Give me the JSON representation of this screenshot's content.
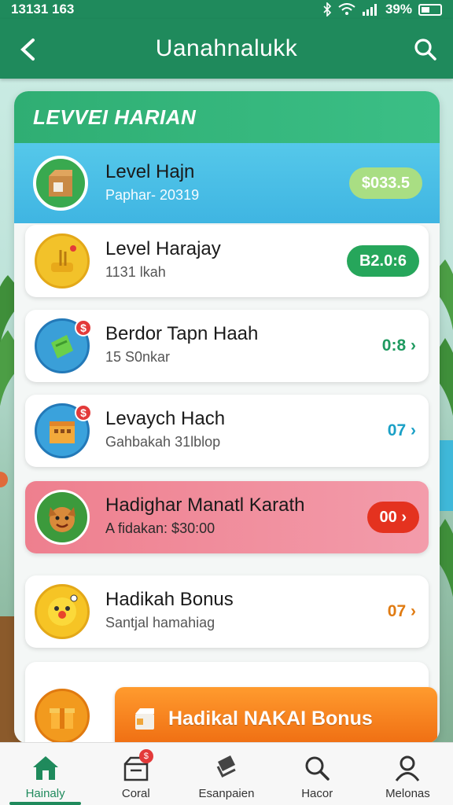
{
  "status_bar": {
    "time": "13131 163",
    "battery": "39%"
  },
  "header": {
    "title": "Uanahnalukk"
  },
  "card": {
    "title": "LEVVEI HARIAN",
    "rows": [
      {
        "title": "Level Hajn",
        "subtitle": "Paphar- 20319",
        "value": "$033.5"
      },
      {
        "title": "Level Harajay",
        "subtitle": "1131 lkah",
        "value": "B2.0:6"
      },
      {
        "title": "Berdor Tapn Haah",
        "subtitle": "15 S0nkar",
        "value": "0:8",
        "badge": "$"
      },
      {
        "title": "Levaych Hach",
        "subtitle": "Gahbakah 31lblop",
        "value": "07",
        "badge": "$"
      },
      {
        "title": "Hadighar Manatl Karath",
        "subtitle": "A fidakan: $30:00",
        "value": "00"
      },
      {
        "title": "Hadikah Bonus",
        "subtitle": "Santjal hamahiag",
        "value": "07"
      }
    ],
    "bonus_button": {
      "label": "Hadikal NAKAI Bonus"
    }
  },
  "bottom_nav": [
    {
      "label": "Hainaly",
      "icon": "home-icon",
      "active": true
    },
    {
      "label": "Coral",
      "icon": "gift-icon",
      "badge": "$"
    },
    {
      "label": "Esanpaien",
      "icon": "layers-icon"
    },
    {
      "label": "Hacor",
      "icon": "search-icon"
    },
    {
      "label": "Melonas",
      "icon": "profile-icon"
    }
  ],
  "colors": {
    "primary": "#1f8a5c",
    "featured_row": "#3fb5e2",
    "pink_row": "#ee7f8e",
    "bonus": "#ff8a20"
  }
}
